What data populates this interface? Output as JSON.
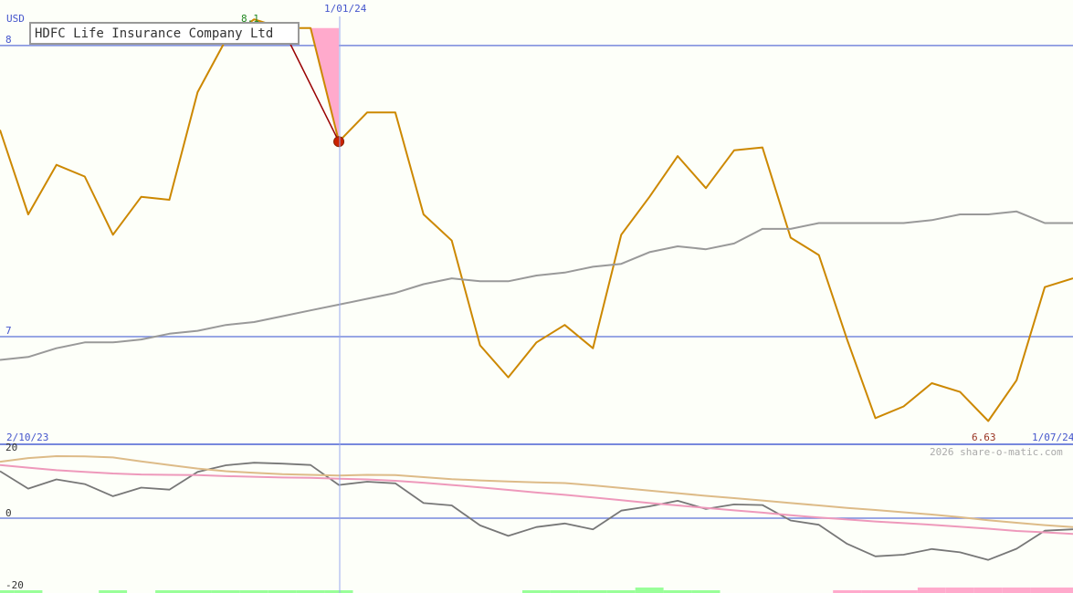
{
  "chart_data": [
    {
      "type": "line",
      "title": "HDFC Life Insurance Company Ltd",
      "currency_label": "USD",
      "ylim": [
        6.63,
        8.1
      ],
      "ylim_labels": {
        "max": "8.1",
        "min": "6.63"
      },
      "y_ticks": [
        {
          "value": 7,
          "label": "7"
        },
        {
          "value": 8,
          "label": "8"
        }
      ],
      "date_start": "2/10/23",
      "date_end": "1/07/24",
      "marker_date": "1/01/24",
      "grid": true,
      "colors": {
        "price": "#cc8800",
        "moving_average": "#999999",
        "gridline": "#7788dd",
        "highlight": "#ffaacc",
        "marker_start": "#6677aa",
        "marker_end": "#cc2200",
        "connector": "#990000"
      },
      "series": [
        {
          "role": "price",
          "values": [
            7.71,
            7.42,
            7.59,
            7.55,
            7.35,
            7.48,
            7.47,
            7.84,
            8.02,
            8.09,
            8.06,
            8.06,
            7.67,
            7.77,
            7.77,
            7.42,
            7.33,
            6.97,
            6.86,
            6.98,
            7.04,
            6.96,
            7.35,
            7.48,
            7.62,
            7.51,
            7.64,
            7.65,
            7.34,
            7.28,
            6.99,
            6.72,
            6.76,
            6.84,
            6.81,
            6.71,
            6.85,
            7.17,
            7.2
          ]
        },
        {
          "role": "moving_average",
          "values": [
            6.92,
            6.93,
            6.96,
            6.98,
            6.98,
            6.99,
            7.01,
            7.02,
            7.04,
            7.05,
            7.07,
            7.09,
            7.11,
            7.13,
            7.15,
            7.18,
            7.2,
            7.19,
            7.19,
            7.21,
            7.22,
            7.24,
            7.25,
            7.29,
            7.31,
            7.3,
            7.32,
            7.37,
            7.37,
            7.39,
            7.39,
            7.39,
            7.39,
            7.4,
            7.42,
            7.42,
            7.43,
            7.39,
            7.39
          ]
        }
      ],
      "marker": {
        "from_value": 8.06,
        "to_value": 7.67
      }
    },
    {
      "type": "line",
      "ylim": [
        -20,
        20
      ],
      "y_ticks": [
        {
          "value": 20,
          "label": "20"
        },
        {
          "value": 0,
          "label": "0"
        },
        {
          "value": -20,
          "label": "-20"
        }
      ],
      "watermark": "2026 share-o-matic.com",
      "colors": {
        "momentum": "#777777",
        "signal_tan": "#ddbb88",
        "signal_pink": "#ee99bb",
        "bar_positive": "#99ff99",
        "bar_negative": "#ffaacc"
      },
      "series": [
        {
          "role": "momentum",
          "values": [
            14.3,
            9.0,
            11.8,
            10.4,
            6.7,
            9.3,
            8.7,
            14.1,
            16.1,
            16.9,
            16.6,
            16.2,
            10.1,
            11.1,
            10.6,
            4.6,
            3.9,
            -2.2,
            -5.4,
            -2.7,
            -1.6,
            -3.4,
            2.3,
            3.6,
            5.3,
            2.8,
            4.2,
            4.0,
            -0.7,
            -2.0,
            -7.8,
            -11.6,
            -11.1,
            -9.4,
            -10.4,
            -12.7,
            -9.3,
            -3.8,
            -3.4
          ]
        },
        {
          "role": "signal_tan",
          "values": [
            17.2,
            18.3,
            18.9,
            18.8,
            18.5,
            17.3,
            16.2,
            15.1,
            14.3,
            13.8,
            13.4,
            13.2,
            13.0,
            13.2,
            13.1,
            12.5,
            11.9,
            11.5,
            11.2,
            10.9,
            10.7,
            10.0,
            9.2,
            8.4,
            7.6,
            6.8,
            6.1,
            5.4,
            4.6,
            3.9,
            3.1,
            2.5,
            1.8,
            1.1,
            0.3,
            -0.6,
            -1.4,
            -2.1,
            -2.7
          ]
        },
        {
          "role": "signal_pink",
          "values": [
            16.2,
            15.4,
            14.6,
            14.1,
            13.6,
            13.3,
            13.2,
            13.1,
            12.8,
            12.6,
            12.4,
            12.3,
            12.0,
            11.8,
            11.4,
            10.8,
            10.1,
            9.4,
            8.6,
            7.8,
            7.1,
            6.3,
            5.5,
            4.6,
            3.9,
            3.1,
            2.4,
            1.7,
            0.9,
            0.2,
            -0.4,
            -1.0,
            -1.5,
            -2.0,
            -2.6,
            -3.2,
            -3.9,
            -4.3,
            -4.8
          ]
        },
        {
          "role": "bars",
          "values": [
            1,
            1,
            0,
            0,
            1,
            0,
            1,
            1,
            1,
            1,
            1,
            1,
            1,
            0,
            0,
            0,
            0,
            0,
            0,
            1,
            1,
            1,
            1,
            2,
            1,
            1,
            0,
            0,
            0,
            0,
            -1,
            -1,
            -1,
            -2,
            -2,
            -2,
            -2,
            -2,
            -2
          ]
        }
      ]
    }
  ]
}
